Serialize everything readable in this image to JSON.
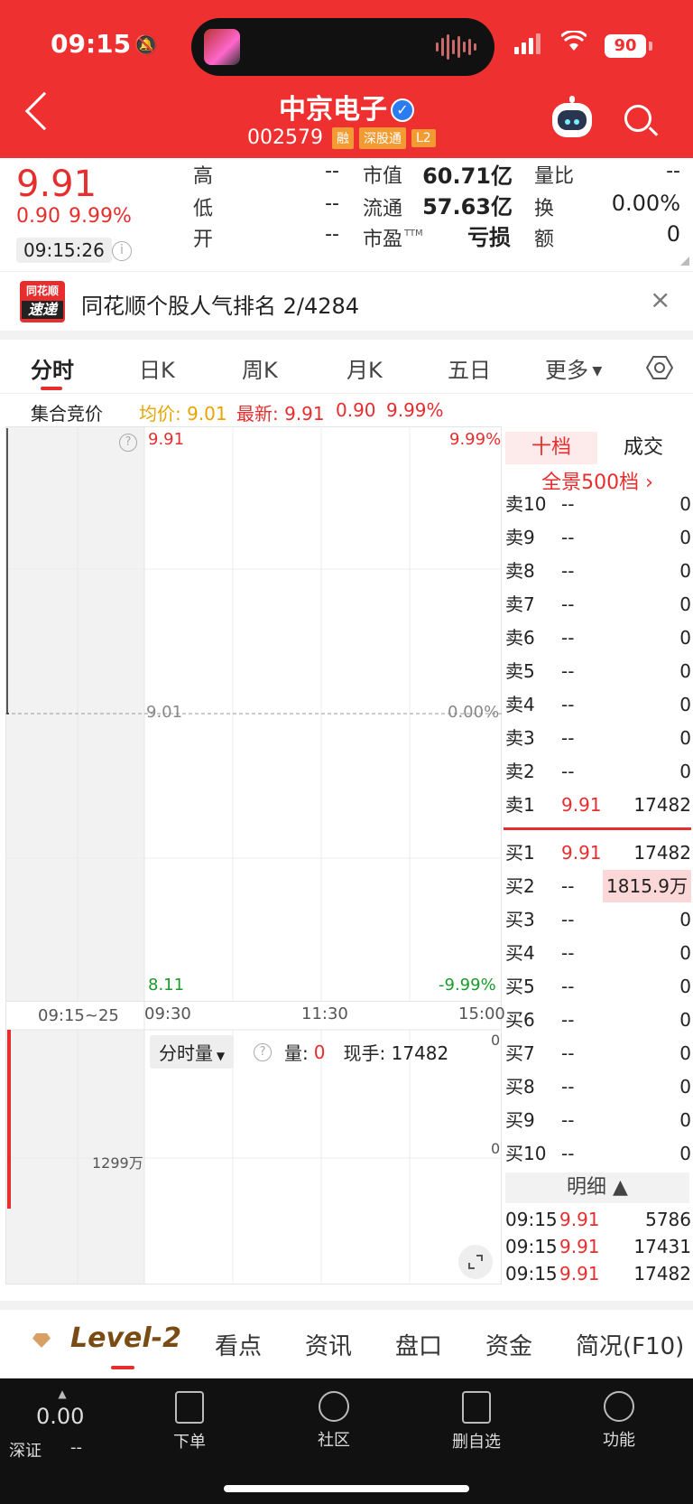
{
  "status_bar": {
    "time": "09:15",
    "battery": "90"
  },
  "header": {
    "name": "中京电子",
    "code": "002579",
    "tags": [
      "融",
      "深股通",
      "L2"
    ]
  },
  "quote": {
    "price": "9.91",
    "change": "0.90",
    "change_pct": "9.99%",
    "time": "09:15:26",
    "fields": {
      "high_label": "高",
      "high": "--",
      "low_label": "低",
      "low": "--",
      "open_label": "开",
      "open": "--",
      "mktcap_label": "市值",
      "mktcap": "60.71亿",
      "float_label": "流通",
      "float": "57.63亿",
      "pe_label": "市盈",
      "pe_sup": "TTM",
      "pe": "亏损",
      "volratio_label": "量比",
      "volratio": "--",
      "turnover_label": "换",
      "turnover": "0.00%",
      "amount_label": "额",
      "amount": "0"
    }
  },
  "banner": {
    "logo_top": "同花顺",
    "logo_bottom": "速递",
    "text": "同花顺个股人气排名 2/4284"
  },
  "tabs": [
    "分时",
    "日K",
    "周K",
    "月K",
    "五日",
    "更多"
  ],
  "legend": {
    "auction": "集合竞价",
    "avg_label": "均价: 9.01",
    "latest_label": "最新: 9.91",
    "change": "0.90",
    "pct": "9.99%"
  },
  "chart": {
    "top_price": "9.91",
    "top_pct": "9.99%",
    "mid_price": "9.01",
    "mid_pct": "0.00%",
    "bottom_price": "8.11",
    "bottom_pct": "-9.99%",
    "time_ticks": [
      "09:15~25",
      "09:30",
      "11:30",
      "15:00"
    ],
    "vol_label": "1299万",
    "vol_zero_top": "0",
    "vol_zero_mid": "0",
    "vol_select": "分时量",
    "vol_qty_label": "量:",
    "vol_qty": "0",
    "vol_hand": "现手: 17482"
  },
  "book": {
    "tabs": [
      "十档",
      "成交"
    ],
    "panorama": "全景500档 ›",
    "asks": [
      {
        "label": "卖10",
        "price": "--",
        "vol": "0"
      },
      {
        "label": "卖9",
        "price": "--",
        "vol": "0"
      },
      {
        "label": "卖8",
        "price": "--",
        "vol": "0"
      },
      {
        "label": "卖7",
        "price": "--",
        "vol": "0"
      },
      {
        "label": "卖6",
        "price": "--",
        "vol": "0"
      },
      {
        "label": "卖5",
        "price": "--",
        "vol": "0"
      },
      {
        "label": "卖4",
        "price": "--",
        "vol": "0"
      },
      {
        "label": "卖3",
        "price": "--",
        "vol": "0"
      },
      {
        "label": "卖2",
        "price": "--",
        "vol": "0"
      },
      {
        "label": "卖1",
        "price": "9.91",
        "vol": "17482"
      }
    ],
    "bids": [
      {
        "label": "买1",
        "price": "9.91",
        "vol": "17482"
      },
      {
        "label": "买2",
        "price": "--",
        "vol": "1815.9万"
      },
      {
        "label": "买3",
        "price": "--",
        "vol": "0"
      },
      {
        "label": "买4",
        "price": "--",
        "vol": "0"
      },
      {
        "label": "买5",
        "price": "--",
        "vol": "0"
      },
      {
        "label": "买6",
        "price": "--",
        "vol": "0"
      },
      {
        "label": "买7",
        "price": "--",
        "vol": "0"
      },
      {
        "label": "买8",
        "price": "--",
        "vol": "0"
      },
      {
        "label": "买9",
        "price": "--",
        "vol": "0"
      },
      {
        "label": "买10",
        "price": "--",
        "vol": "0"
      }
    ],
    "detail_label": "明细 ▲",
    "trades": [
      {
        "time": "09:15",
        "price": "9.91",
        "vol": "5786"
      },
      {
        "time": "09:15",
        "price": "9.91",
        "vol": "17431"
      },
      {
        "time": "09:15",
        "price": "9.91",
        "vol": "17482"
      }
    ]
  },
  "bottom_tabs": [
    "Level-2",
    "看点",
    "资讯",
    "盘口",
    "资金",
    "简况(F10)"
  ],
  "nav": {
    "market_value": "0.00",
    "market_name": "深证",
    "market_change": "--",
    "items": [
      "下单",
      "社区",
      "删自选",
      "功能"
    ]
  },
  "colors": {
    "up": "#e62e2e",
    "header_bg": "#ee3030",
    "avg": "#e8a400",
    "down": "#1a9a2a"
  }
}
